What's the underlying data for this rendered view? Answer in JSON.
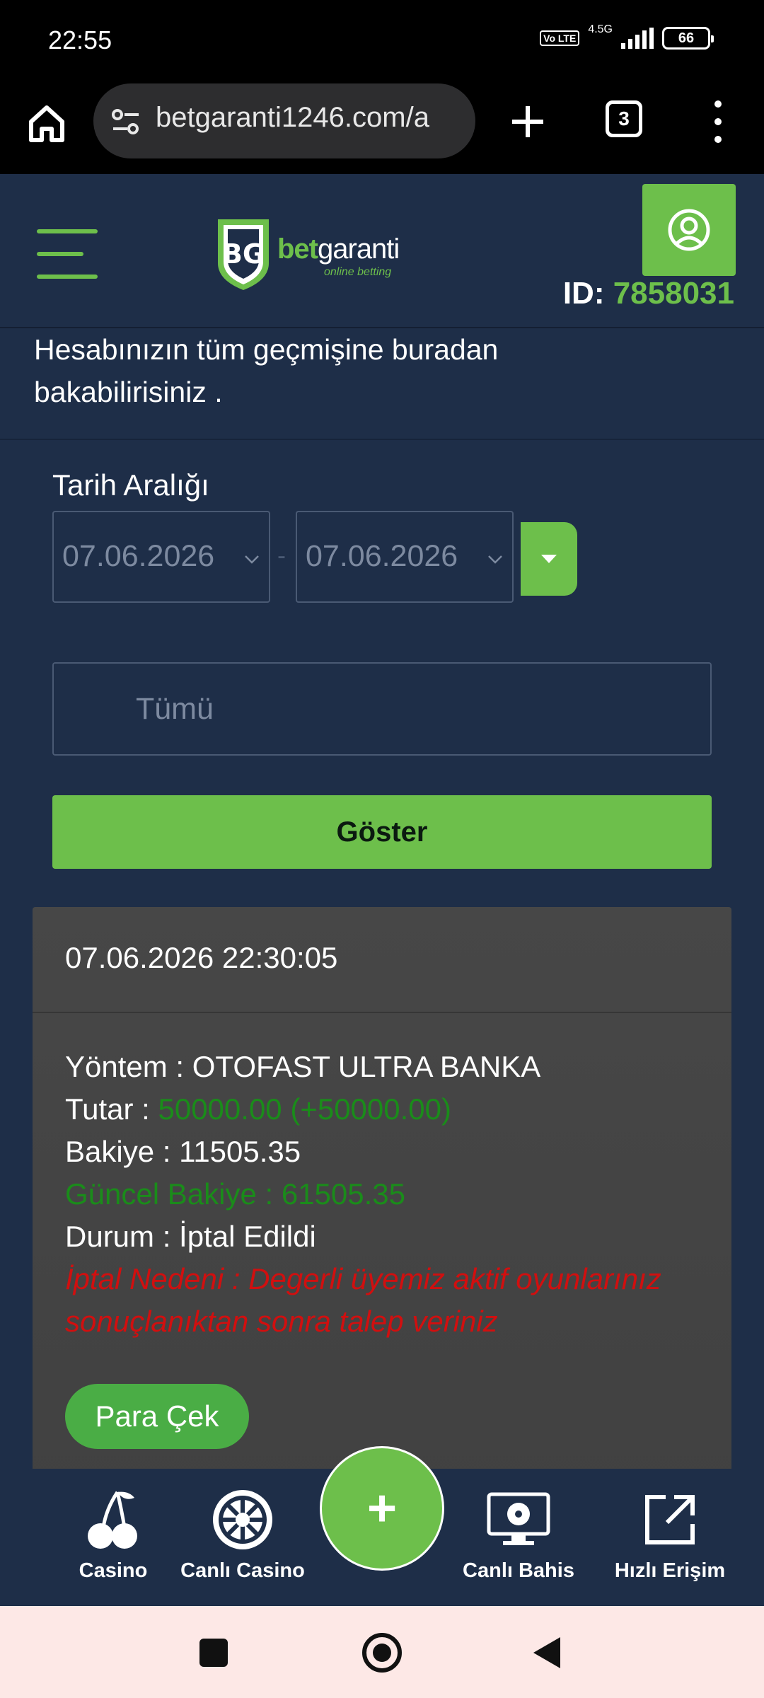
{
  "status_bar": {
    "time": "22:55",
    "volte": "Vo LTE",
    "network": "4.5G",
    "battery": "66"
  },
  "browser": {
    "url": "betgaranti1246.com/a",
    "tab_count": "3"
  },
  "header": {
    "logo_text_1": "bet",
    "logo_text_2": "garanti",
    "logo_sub": "online betting",
    "id_label": "ID:",
    "id_value": "7858031"
  },
  "intro": {
    "text": "Hesabınızın tüm geçmişine buradan bakabilirisiniz ."
  },
  "filter": {
    "date_label": "Tarih Aralığı",
    "date_from": "07.06.2026",
    "date_separator": "-",
    "date_to": "07.06.2026",
    "type_value": "Tümü",
    "show_button": "Göster"
  },
  "transaction": {
    "datetime": "07.06.2026 22:30:05",
    "method_label": "Yöntem : ",
    "method_value": "OTOFAST ULTRA BANKA",
    "amount_label": "Tutar : ",
    "amount_value": "50000.00 (+50000.00)",
    "balance_label": "Bakiye : ",
    "balance_value": "11505.35",
    "current_balance": "Güncel Bakiye : 61505.35",
    "status_label": "Durum : ",
    "status_value": "İptal Edildi",
    "cancel_reason": "İptal Nedeni : Degerli üyemiz aktif oyunlarınız sonuçlanıktan sonra talep veriniz",
    "withdraw_button": "Para Çek"
  },
  "bottom_nav": {
    "items": [
      {
        "label": "Casino",
        "icon": "cherry-icon"
      },
      {
        "label": "Canlı Casino",
        "icon": "roulette-icon"
      },
      {
        "label": "+",
        "icon": "plus-icon"
      },
      {
        "label": "Canlı Bahis",
        "icon": "monitor-ball-icon"
      },
      {
        "label": "Hızlı Erişim",
        "icon": "external-link-icon"
      }
    ]
  },
  "colors": {
    "accent": "#6dbf4b",
    "background": "#1e2e48",
    "card": "#444444",
    "success_text": "#1a8c1a",
    "error_text": "#d10f0f"
  }
}
